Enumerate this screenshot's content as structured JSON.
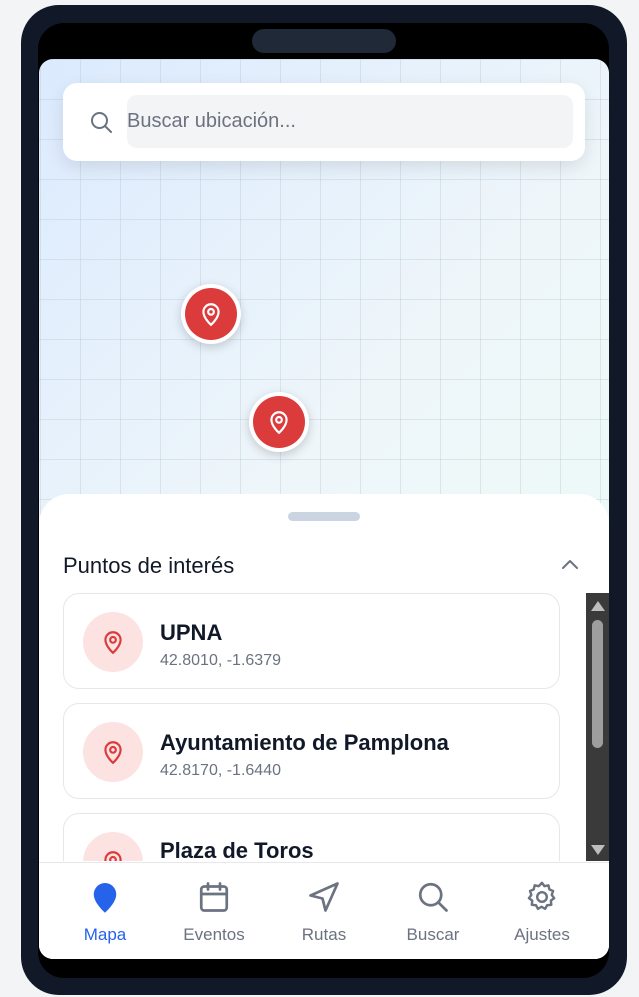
{
  "search": {
    "placeholder": "Buscar ubicación..."
  },
  "map": {
    "markers": [
      {
        "icon": "map-pin-icon"
      },
      {
        "icon": "map-pin-icon"
      }
    ]
  },
  "sheet": {
    "title": "Puntos de interés",
    "points": [
      {
        "name": "UPNA",
        "coords": "42.8010, -1.6379"
      },
      {
        "name": "Ayuntamiento de Pamplona",
        "coords": "42.8170, -1.6440"
      },
      {
        "name": "Plaza de Toros",
        "coords": ""
      }
    ]
  },
  "nav": {
    "items": [
      {
        "label": "Mapa",
        "icon": "map-pin-icon",
        "active": true
      },
      {
        "label": "Eventos",
        "icon": "calendar-icon",
        "active": false
      },
      {
        "label": "Rutas",
        "icon": "navigation-icon",
        "active": false
      },
      {
        "label": "Buscar",
        "icon": "search-icon",
        "active": false
      },
      {
        "label": "Ajustes",
        "icon": "gear-icon",
        "active": false
      }
    ]
  },
  "colors": {
    "accent": "#2563eb",
    "marker": "#dc3b3b",
    "marker_soft": "#fde2e2"
  }
}
